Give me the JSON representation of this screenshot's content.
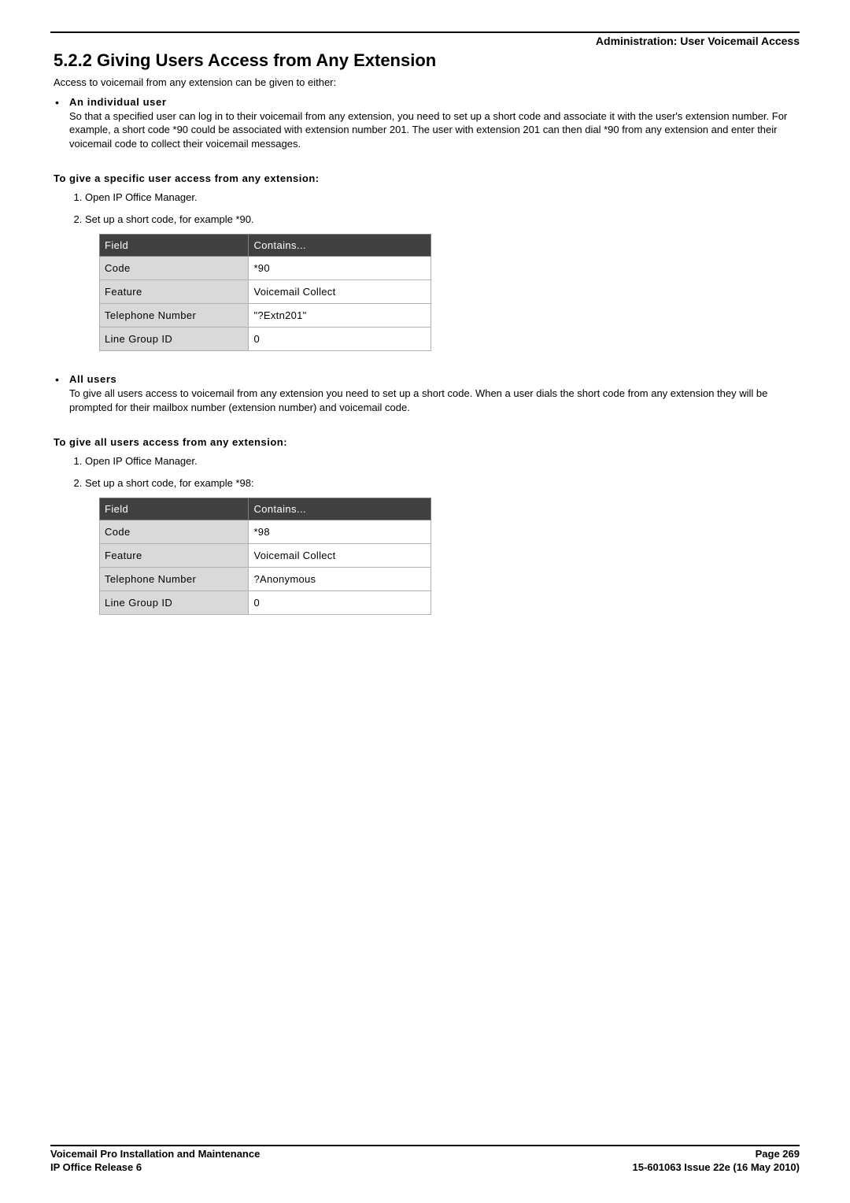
{
  "header": {
    "right": "Administration: User Voicemail Access"
  },
  "title": "5.2.2 Giving Users Access from Any Extension",
  "intro": "Access to voicemail from any extension can be given to either:",
  "bullet1": {
    "lead": "An individual user",
    "desc": "So that a specified user can log in to their voicemail from any extension, you need to set up a short code and associate it with the user's extension number. For example, a short code *90 could be associated with extension number 201. The user with extension 201 can then dial *90 from any extension and enter their voicemail code to collect their voicemail messages."
  },
  "sub1": "To give a specific user access from any extension:",
  "steps1": {
    "s1": "Open IP Office Manager.",
    "s2": "Set up a short code, for example *90."
  },
  "table_headers": {
    "field": "Field",
    "contains": "Contains..."
  },
  "table1": {
    "r1": {
      "label": "Code",
      "value": "*90"
    },
    "r2": {
      "label": "Feature",
      "value": "Voicemail Collect"
    },
    "r3": {
      "label": "Telephone Number",
      "value": "\"?Extn201\""
    },
    "r4": {
      "label": "Line Group ID",
      "value": "0"
    }
  },
  "bullet2": {
    "lead": "All users",
    "desc": "To give all users access to voicemail from any extension you need to set up a short code. When a user dials the short code from any extension they will be prompted for their mailbox number (extension number) and voicemail code."
  },
  "sub2": "To give all users access from any extension:",
  "steps2": {
    "s1": "Open IP Office Manager.",
    "s2": "Set up a short code, for example *98:"
  },
  "table2": {
    "r1": {
      "label": "Code",
      "value": "*98"
    },
    "r2": {
      "label": "Feature",
      "value": "Voicemail Collect"
    },
    "r3": {
      "label": "Telephone Number",
      "value": "?Anonymous"
    },
    "r4": {
      "label": "Line Group ID",
      "value": "0"
    }
  },
  "footer": {
    "left1": "Voicemail Pro Installation and Maintenance",
    "left2": "IP Office Release 6",
    "right1": "Page 269",
    "right2": "15-601063 Issue 22e (16 May 2010)"
  },
  "chart_data": [
    {
      "type": "table",
      "title": "Short code for specific user access (*90)",
      "columns": [
        "Field",
        "Contains..."
      ],
      "rows": [
        [
          "Code",
          "*90"
        ],
        [
          "Feature",
          "Voicemail Collect"
        ],
        [
          "Telephone Number",
          "\"?Extn201\""
        ],
        [
          "Line Group ID",
          "0"
        ]
      ]
    },
    {
      "type": "table",
      "title": "Short code for all users access (*98)",
      "columns": [
        "Field",
        "Contains..."
      ],
      "rows": [
        [
          "Code",
          "*98"
        ],
        [
          "Feature",
          "Voicemail Collect"
        ],
        [
          "Telephone Number",
          "?Anonymous"
        ],
        [
          "Line Group ID",
          "0"
        ]
      ]
    }
  ]
}
